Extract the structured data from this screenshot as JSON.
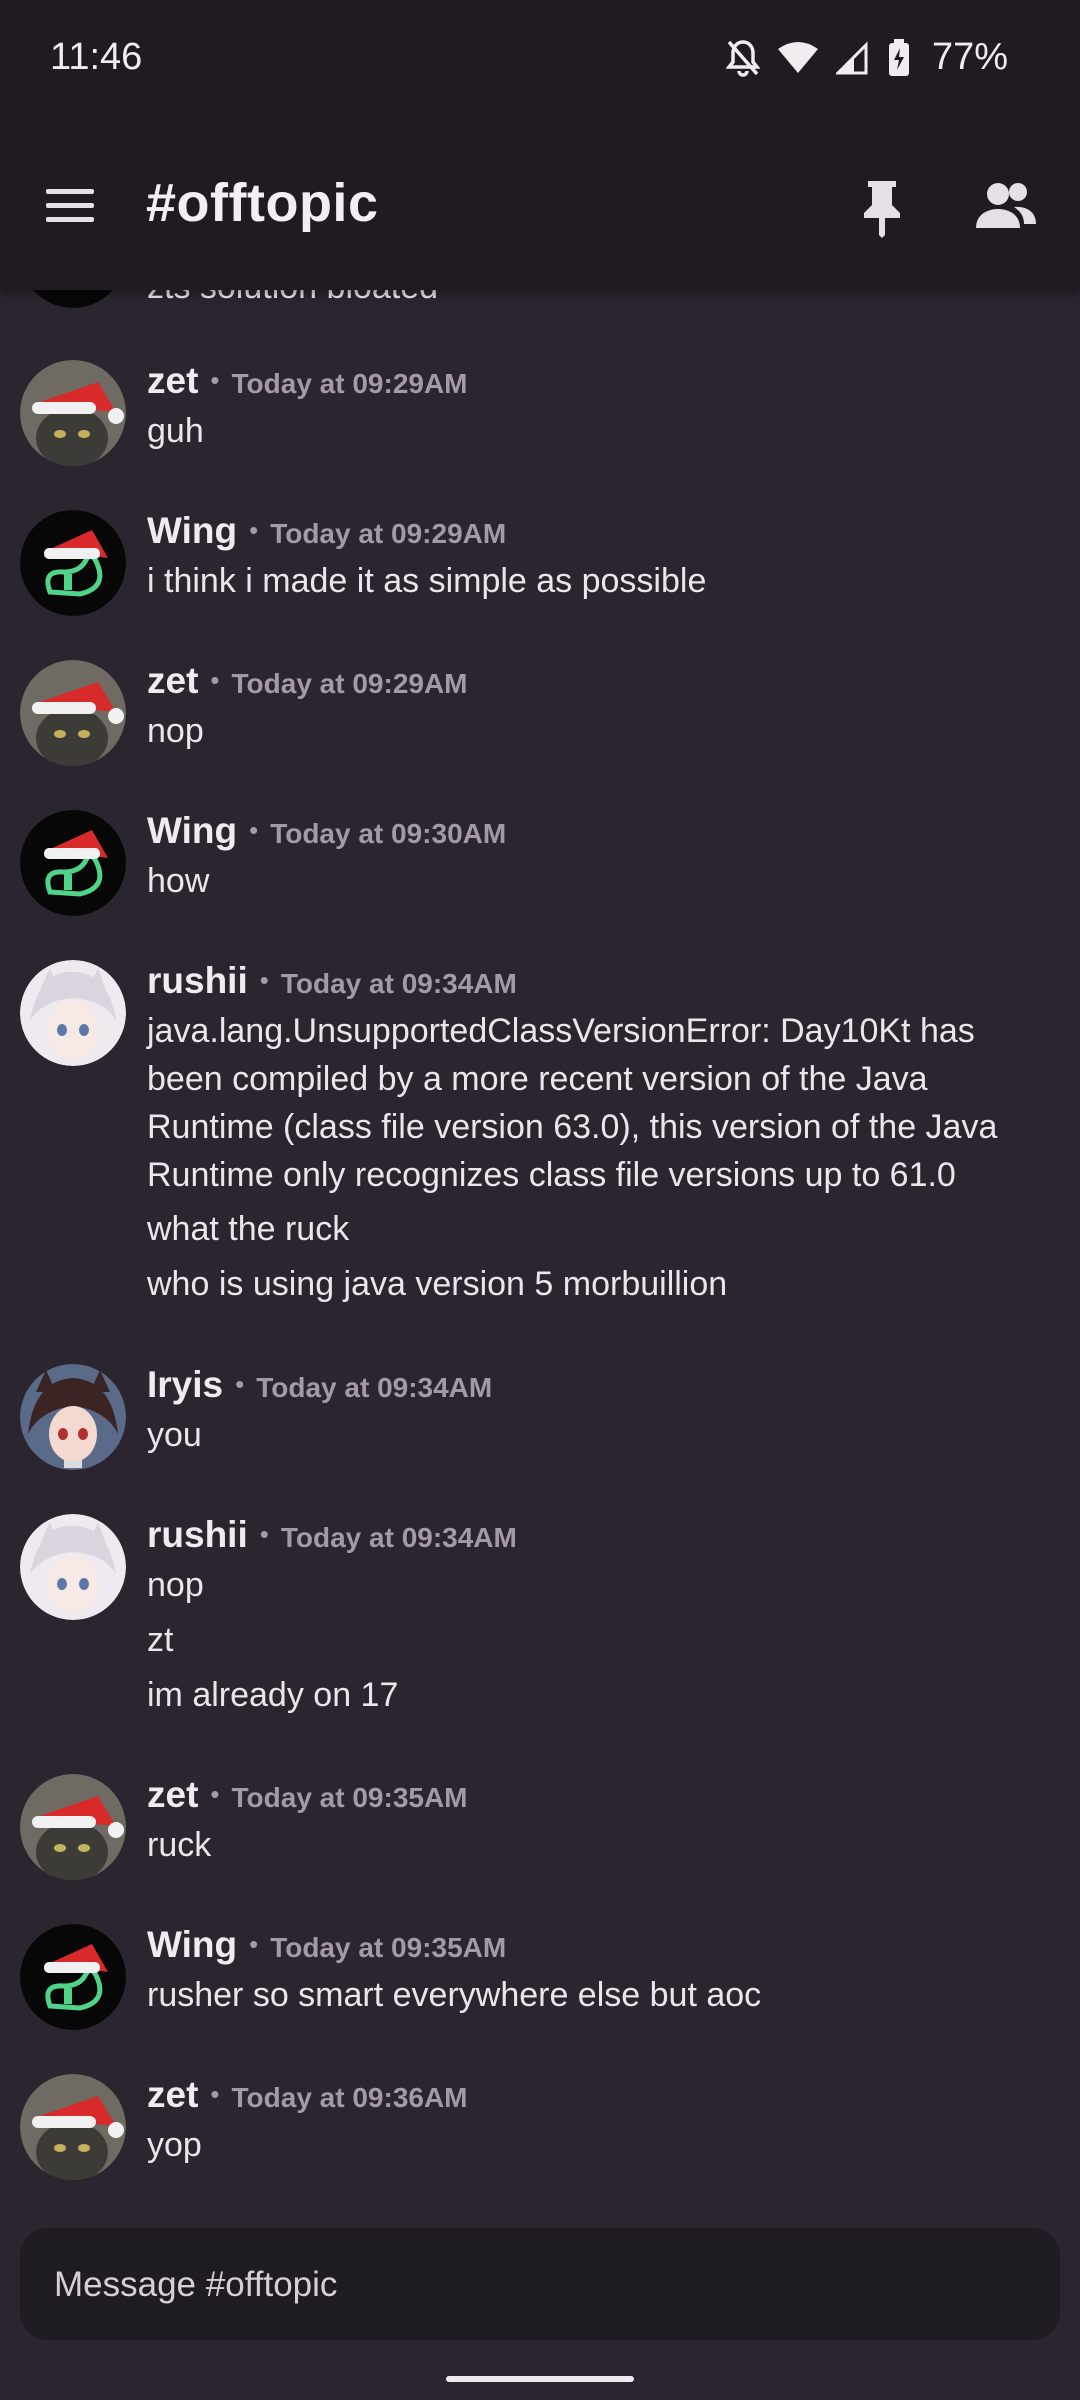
{
  "status_bar": {
    "time": "11:46",
    "battery": "77%",
    "icons": [
      "notifications-off-icon",
      "wifi-icon",
      "cell-signal-icon",
      "battery-charging-icon"
    ]
  },
  "header": {
    "channel": "#offtopic",
    "icons": [
      "menu-icon",
      "pin-icon",
      "members-icon"
    ]
  },
  "messages": [
    {
      "author": "",
      "timestamp": "",
      "lines": [
        "zts solution bloated"
      ],
      "avatar": "wing-avatar"
    },
    {
      "author": "zet",
      "timestamp": "Today at 09:29AM",
      "lines": [
        "guh"
      ],
      "avatar": "cat-santa-avatar"
    },
    {
      "author": "Wing",
      "timestamp": "Today at 09:29AM",
      "lines": [
        "i think i made it as simple as possible"
      ],
      "avatar": "wing-avatar"
    },
    {
      "author": "zet",
      "timestamp": "Today at 09:29AM",
      "lines": [
        "nop"
      ],
      "avatar": "cat-santa-avatar"
    },
    {
      "author": "Wing",
      "timestamp": "Today at 09:30AM",
      "lines": [
        "how"
      ],
      "avatar": "wing-avatar"
    },
    {
      "author": "rushii",
      "timestamp": "Today at 09:34AM",
      "lines": [
        "java.lang.UnsupportedClassVersionError: Day10Kt has",
        "been compiled by a more recent version of the Java",
        "Runtime (class file version 63.0), this version of the Java",
        "Runtime only recognizes class file versions up to 61.0",
        "what the ruck",
        "who is using java version 5 morbuillion"
      ],
      "avatar": "anime-white-hair-avatar"
    },
    {
      "author": "Iryis",
      "timestamp": "Today at 09:34AM",
      "lines": [
        "you"
      ],
      "avatar": "anime-dark-hair-avatar"
    },
    {
      "author": "rushii",
      "timestamp": "Today at 09:34AM",
      "lines": [
        "nop",
        "zt",
        "im already on 17"
      ],
      "avatar": "anime-white-hair-avatar"
    },
    {
      "author": "zet",
      "timestamp": "Today at 09:35AM",
      "lines": [
        "ruck"
      ],
      "avatar": "cat-santa-avatar"
    },
    {
      "author": "Wing",
      "timestamp": "Today at 09:35AM",
      "lines": [
        "rusher so smart everywhere else but aoc"
      ],
      "avatar": "wing-avatar"
    },
    {
      "author": "zet",
      "timestamp": "Today at 09:36AM",
      "lines": [
        "yop"
      ],
      "avatar": "cat-santa-avatar"
    }
  ],
  "composer": {
    "placeholder": "Message #offtopic"
  }
}
